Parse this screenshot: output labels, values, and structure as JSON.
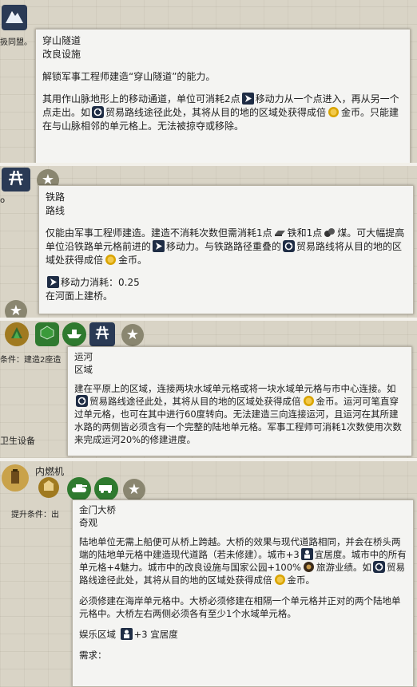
{
  "panels": {
    "tunnel": {
      "side_text": "扱同盟。",
      "title": "穿山隧道",
      "subtitle": "改良设施",
      "p1": "解锁军事工程师建造“穿山隧道”的能力。",
      "p2_a": "其用作山脉地形上的移动通道，单位可消耗2点",
      "p2_b": "移动力从一个点进入，再从另一个点走出。如",
      "p2_c": "贸易路线途径此处，其将从目的地的区域处获得成倍",
      "p2_d": "金币。只能建在与山脉相邻的单元格上。无法被掠夺或移除。"
    },
    "railroad": {
      "side_text": "o",
      "title": "铁路",
      "subtitle": "路线",
      "p1_a": "仅能由军事工程师建造。建造不消耗次数但需消耗1点",
      "p1_b": "铁和1点",
      "p1_c": "煤。可大幅提高单位沿铁路单元格前进的",
      "p1_d": "移动力。与铁路路径重叠的",
      "p1_e": "贸易路线将从目的地的区域处获得成倍",
      "p1_f": "金币。",
      "move_label": "移动力消耗：0.25",
      "river": "在河面上建桥。"
    },
    "canal": {
      "side_text_1": "条件：建造2座造",
      "side_text_2": "卫生设备",
      "title": "运河",
      "subtitle": "区域",
      "p1_a": "建在平原上的区域，连接两块水域单元格或将一块水域单元格与市中心连接。如",
      "p1_b": "贸易路线途径此处，其将从目的地的区域处获得成倍",
      "p1_c": "金币。运河可笔直穿过单元格，也可在其中进行60度转向。无法建造三向连接运河，且运河在其所建水路的两侧皆必须含有一个完整的陆地单元格。军事工程师可消耗1次数使用次数来完成运河20%的修建进度。"
    },
    "bridge": {
      "side_title": "内燃机",
      "side_text": "提升条件：出",
      "title": "金门大桥",
      "subtitle": "奇观",
      "p1_a": "陆地单位无需上船便可从桥上跨越。大桥的效果与现代道路相同，并会在桥头两端的陆地单元格中建造现代道路（若未修建）。城市+3",
      "p1_b": "宜居度。城市中的所有单元格+4魅力。城市中的改良设施与国家公园+100%",
      "p1_c": "旅游业绩。如",
      "p1_d": "贸易路线途径此处，其将从目的地的区域处获得成倍",
      "p1_e": "金币。",
      "p2": "必须修建在海岸单元格中。大桥必须修建在相隔一个单元格并正对的两个陆地单元格中。大桥左右两侧必须各有至少1个水域单元格。",
      "entertainment_a": "娱乐区域",
      "entertainment_b": "+3 宜居度",
      "requires": "需求："
    }
  },
  "colors": {
    "card_bg": "#f4f4f2",
    "map_bg": "#d9d4c6",
    "dark_button": "#2a3a55",
    "green_button": "#2f7a2f",
    "gold": "#d9a400"
  },
  "icons": [
    "mountain-icon",
    "movement-icon",
    "trade-route-icon",
    "gold-icon",
    "railroad-icon",
    "star-icon",
    "iron-icon",
    "coal-icon",
    "district-icon",
    "harbor-icon",
    "amenity-icon",
    "tourism-icon",
    "wonder-icon",
    "oil-icon",
    "tank-icon"
  ]
}
